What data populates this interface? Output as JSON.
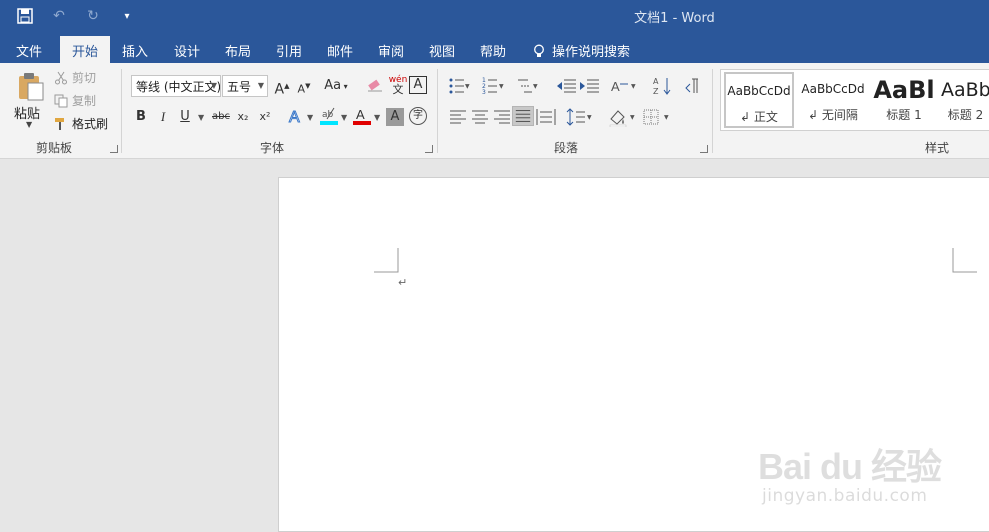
{
  "window": {
    "title": "文档1  -  Word"
  },
  "quick_access": [
    "save-icon",
    "undo-icon",
    "redo-icon",
    "customize-icon"
  ],
  "tabs": [
    {
      "label": "文件"
    },
    {
      "label": "开始"
    },
    {
      "label": "插入"
    },
    {
      "label": "设计"
    },
    {
      "label": "布局"
    },
    {
      "label": "引用"
    },
    {
      "label": "邮件"
    },
    {
      "label": "审阅"
    },
    {
      "label": "视图"
    },
    {
      "label": "帮助"
    },
    {
      "label": "操作说明搜索"
    }
  ],
  "active_tab": "开始",
  "clipboard": {
    "paste": "粘贴",
    "cut": "剪切",
    "copy": "复制",
    "format_painter": "格式刷",
    "group_label": "剪贴板"
  },
  "font": {
    "font_name": "等线 (中文正文)",
    "font_size": "五号",
    "group_label": "字体",
    "grow": "A",
    "shrink": "A",
    "case": "Aa",
    "bold": "B",
    "italic": "I",
    "underline": "U",
    "strike": "abc",
    "subscript": "x₂",
    "superscript": "x²",
    "phonetic": "wén",
    "border_char": "A",
    "shade_char": "A",
    "enclose": "字"
  },
  "paragraph": {
    "group_label": "段落"
  },
  "styles": {
    "group_label": "样式",
    "items": [
      {
        "preview": "AaBbCcDd",
        "name": "正文"
      },
      {
        "preview": "AaBbCcDd",
        "name": "无间隔"
      },
      {
        "preview": "AaBl",
        "name": "标题 1"
      },
      {
        "preview": "AaBb",
        "name": "标题 2"
      }
    ]
  },
  "document": {
    "paragraph_mark": "↵"
  },
  "watermark": {
    "logo": "Bai du 经验",
    "url": "jingyan.baidu.com"
  },
  "colors": {
    "ribbon_blue": "#2b579a",
    "highlight": "#00e5ff",
    "font_color": "#e00000"
  }
}
